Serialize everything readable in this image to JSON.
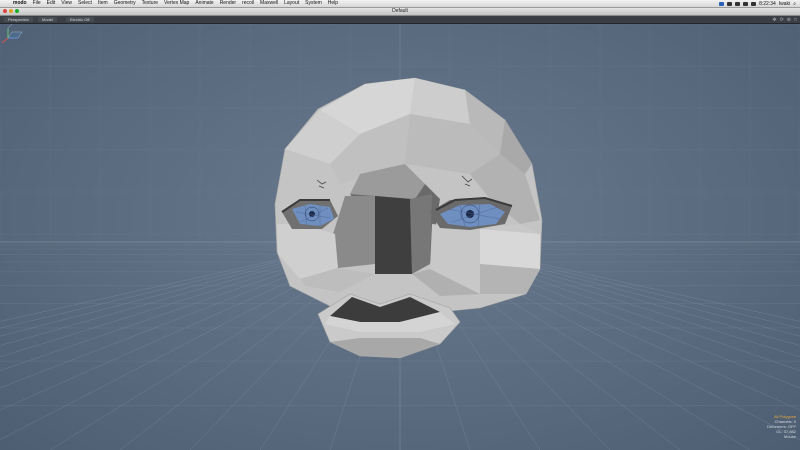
{
  "menubar": {
    "items": [
      "modo",
      "File",
      "Edit",
      "View",
      "Select",
      "Item",
      "Geometry",
      "Texture",
      "Vertex Map",
      "Animate",
      "Render",
      "recoil",
      "Maxwell",
      "Layout",
      "System",
      "Help"
    ],
    "clock": "8:22:34",
    "user": "Iwaki"
  },
  "window": {
    "title": "Default"
  },
  "toolbar": {
    "buttons": [
      "Perspective",
      "Model",
      "Electric Off"
    ]
  },
  "info": {
    "lines": [
      "All Polygons",
      "Channels: 0",
      "Deformers: OFF",
      "GL: 37,882",
      "Mouse"
    ]
  },
  "colors": {
    "viewport_bg": "#5a6a7e",
    "grid": "#8796a8",
    "mesh_light": "#c8c8c8",
    "mesh_dark": "#3c3c3c",
    "eye": "#6f8fc0",
    "info_highlight": "#e8a93a"
  },
  "icons": {
    "apple": "apple-icon",
    "gizmo": "axis-gizmo-icon"
  }
}
